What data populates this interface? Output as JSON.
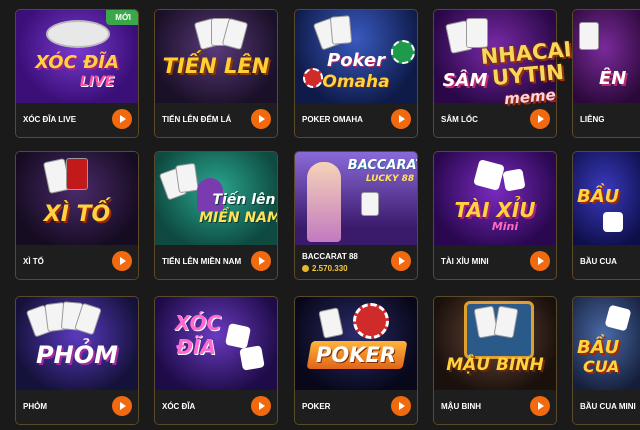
{
  "games": [
    {
      "name": "XÓC ĐĨA LIVE",
      "badge": "MỚI",
      "title": "XÓC ĐĨA",
      "subtitle": "LIVE",
      "colors": {
        "bg": "#5a1fa0"
      }
    },
    {
      "name": "TIẾN LÊN ĐẾM LÁ",
      "title": "TIẾN LÊN",
      "colors": {
        "bg": "#2a1c3d"
      }
    },
    {
      "name": "POKER OMAHA",
      "title": "Poker",
      "subtitle": "Omaha",
      "colors": {
        "bg": "#1c2a5a"
      }
    },
    {
      "name": "SÂM LỐC",
      "title": "SÂM",
      "colors": {
        "bg": "#3a1060"
      }
    },
    {
      "name": "LIÊNG",
      "title": "ÊN",
      "colors": {
        "bg": "#4a1060"
      }
    },
    {
      "name": "XÌ TỐ",
      "title": "XÌ TỐ",
      "colors": {
        "bg": "#2a1a40"
      }
    },
    {
      "name": "TIẾN LÊN MIỀN NAM",
      "title": "Tiến lên",
      "subtitle": "MIỀN NAM",
      "colors": {
        "bg": "#1d7a6a"
      }
    },
    {
      "name": "BACCARAT 88",
      "amount": "2.570.330",
      "title": "BACCARAT",
      "subtitle": "LUCKY 88",
      "colors": {
        "bg": "#4a2a7a"
      }
    },
    {
      "name": "TÀI XỈU MINI",
      "title": "TÀI XỈU",
      "subtitle": "Mini",
      "colors": {
        "bg": "#3a1070"
      }
    },
    {
      "name": "BẦU CUA",
      "title": "BẦU",
      "colors": {
        "bg": "#2a2a6a"
      }
    },
    {
      "name": "PHỎM",
      "title": "PHỎM",
      "colors": {
        "bg": "#1a1a50"
      }
    },
    {
      "name": "XÓC ĐĨA",
      "title": "XÓC",
      "subtitle": "ĐĨA",
      "colors": {
        "bg": "#3a1a70"
      }
    },
    {
      "name": "POKER",
      "title": "POKER",
      "colors": {
        "bg": "#12122a"
      }
    },
    {
      "name": "MẬU BINH",
      "title": "MẬU BINH",
      "colors": {
        "bg": "#3a2420"
      }
    },
    {
      "name": "BẦU CUA MINI",
      "title": "BẦU",
      "subtitle": "CUA",
      "colors": {
        "bg": "#2a3a5a"
      }
    }
  ],
  "watermark": {
    "line1": "NHACAI",
    "line2": "UYTIN",
    "line3": "meme"
  },
  "colors": {
    "accent": "#f26a10",
    "new_badge": "#3aa84a",
    "border": "#5a4a2a",
    "amount": "#f3c843"
  }
}
